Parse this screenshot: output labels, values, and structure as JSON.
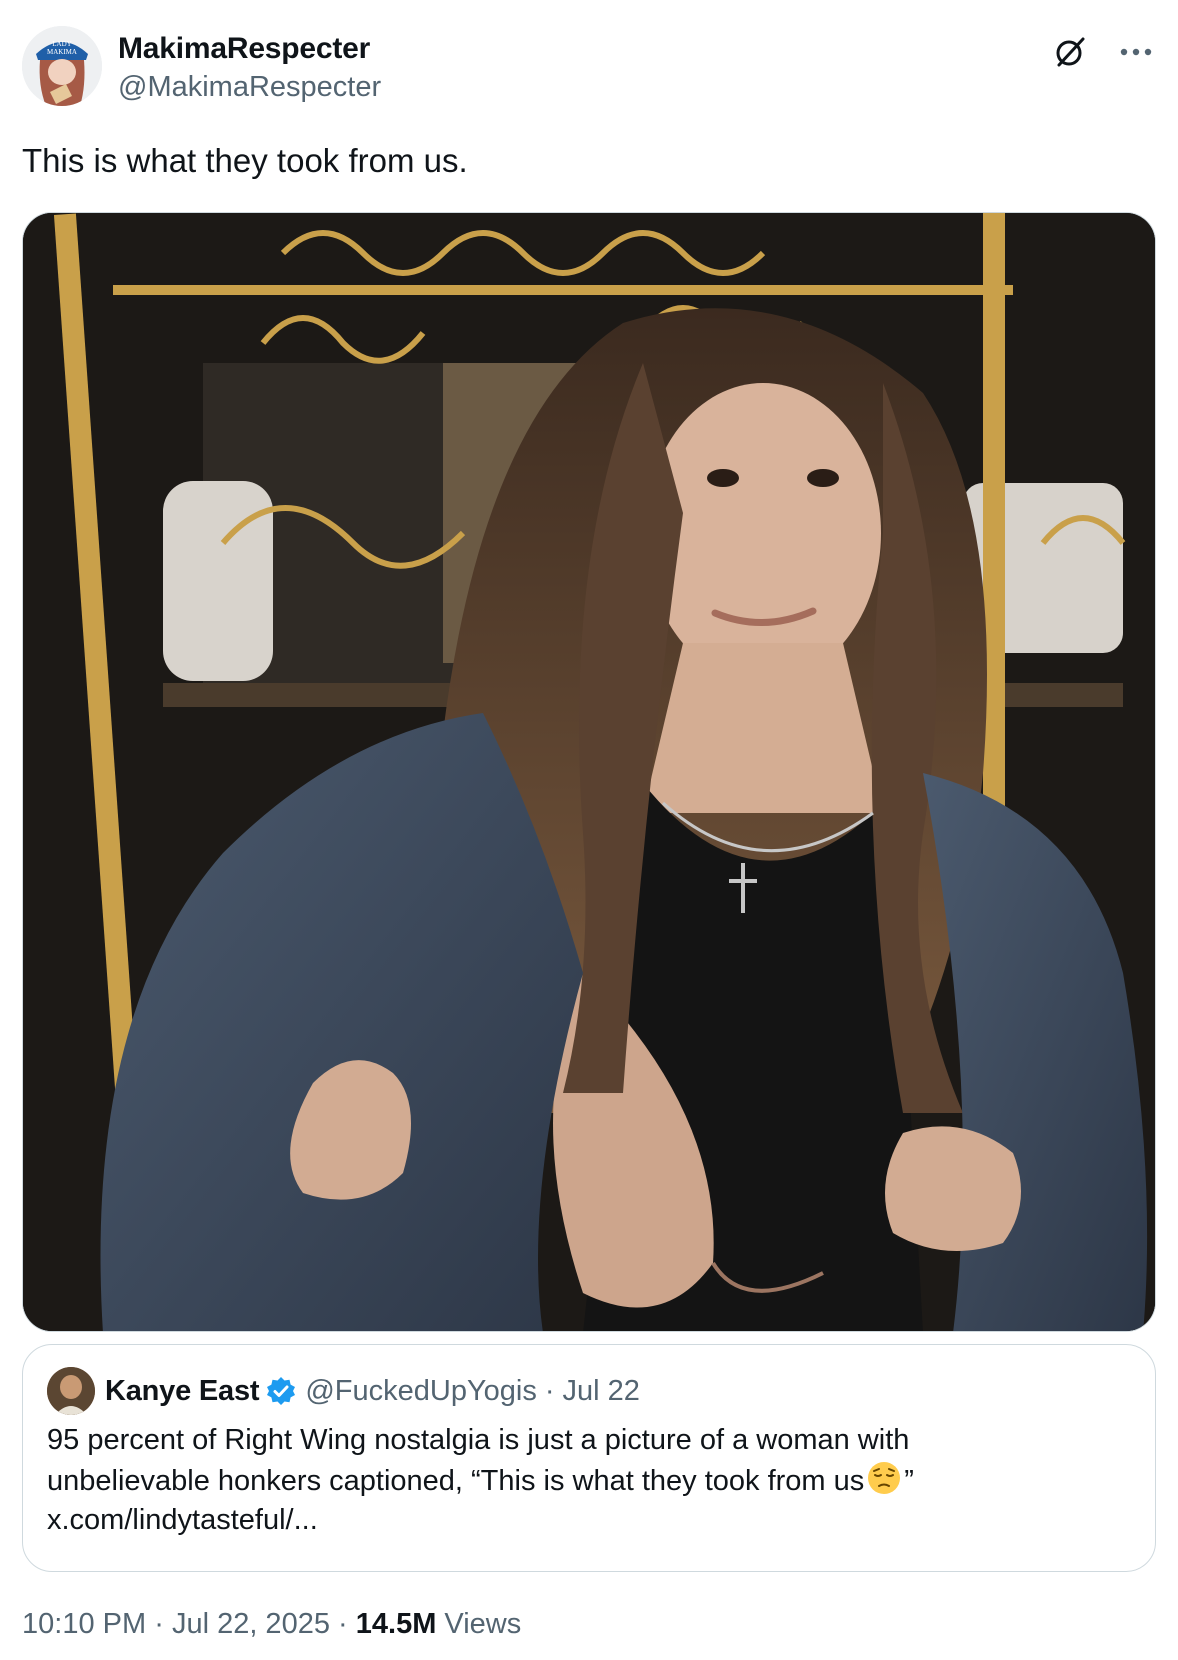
{
  "author": {
    "display_name": "MakimaRespecter",
    "handle": "@MakimaRespecter",
    "avatar_cap_text": "LADY MAKIMA"
  },
  "header_icons": {
    "grok": "grok-icon",
    "more": "more-icon"
  },
  "tweet": {
    "text": "This is what they took from us."
  },
  "media": {
    "alt": "photo-of-woman-in-denim-jacket"
  },
  "quote": {
    "display_name": "Kanye East",
    "handle": "@FuckedUpYogis",
    "separator": "·",
    "date": "Jul 22",
    "text_before_emoji": "95 percent of Right Wing nostalgia is just a picture of a woman with unbelievable honkers captioned, “This is what they took from us",
    "text_after_emoji": "”",
    "link": "x.com/lindytasteful/..."
  },
  "footer": {
    "time": "10:10 PM",
    "sep1": "·",
    "date": "Jul 22, 2025",
    "sep2": "·",
    "views_count": "14.5M",
    "views_label": "Views"
  },
  "colors": {
    "text_primary": "#0f1419",
    "text_secondary": "#536471",
    "border": "#cfd9de",
    "verified": "#1d9bf0"
  }
}
